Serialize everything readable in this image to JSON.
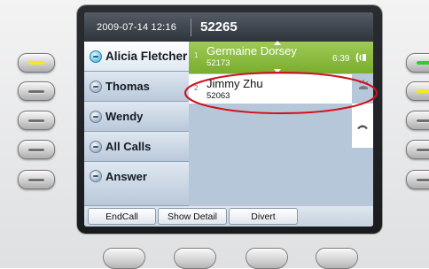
{
  "header": {
    "datetime": "2009-07-14 12:16",
    "extension": "52265"
  },
  "line_keys": [
    {
      "label": "Alicia Fletcher",
      "icon": "line-status-icon",
      "active": true
    },
    {
      "label": "Thomas",
      "icon": "speed-dial-icon"
    },
    {
      "label": "Wendy",
      "icon": "speed-dial-icon"
    },
    {
      "label": "All Calls",
      "icon": "all-calls-icon"
    },
    {
      "label": "Answer",
      "icon": "answer-icon"
    }
  ],
  "calls": [
    {
      "index": "1",
      "name": "Germaine Dorsey",
      "number": "52173",
      "timer": "6:39",
      "state": "connected",
      "state_icon": "connected-call-icon"
    },
    {
      "index": "2",
      "name": "Jimmy Zhu",
      "number": "52063",
      "state": "ringing",
      "state_icon": "ringing-icon"
    }
  ],
  "side_action_icon": "hang-up-icon",
  "softkeys": [
    {
      "label": "EndCall"
    },
    {
      "label": "Show Detail"
    },
    {
      "label": "Divert"
    }
  ],
  "colors": {
    "connected_call": "#79ad2d",
    "highlight_ellipse": "#d0111b",
    "led_green": "#2ecc2e",
    "led_yellow": "#f2ea1c"
  }
}
